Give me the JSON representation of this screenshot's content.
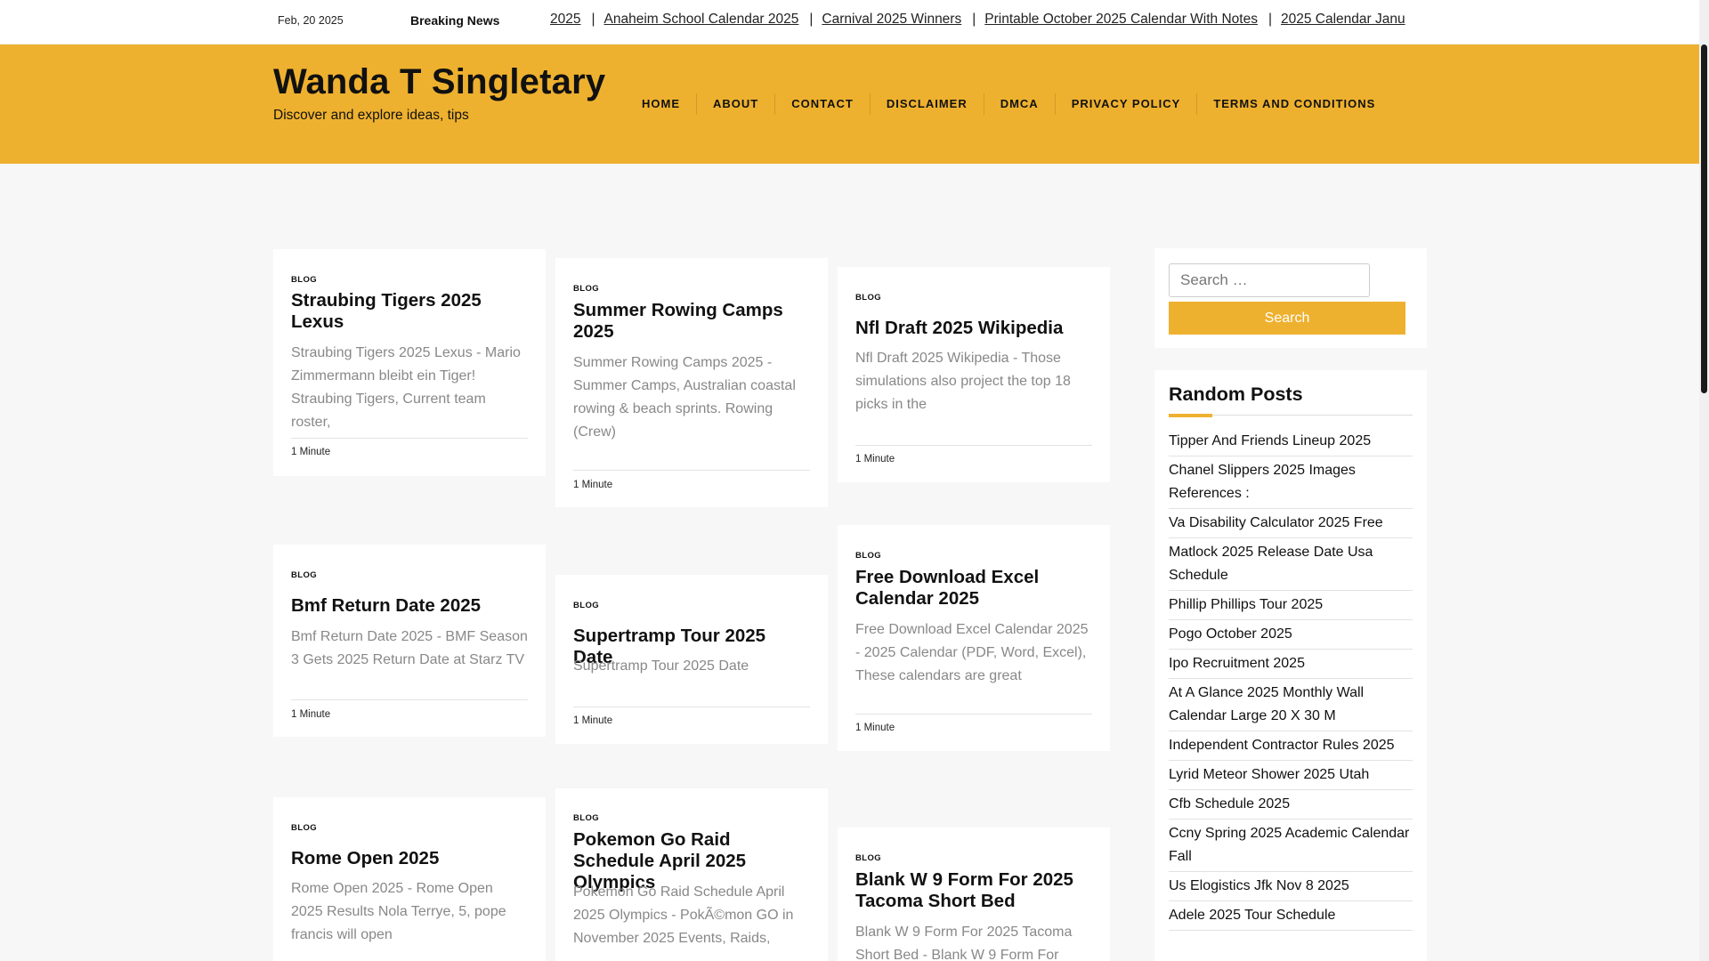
{
  "topbar": {
    "date": "Feb, 20 2025",
    "breaking_label": "Breaking News",
    "ticker": [
      "2025",
      "Anaheim School Calendar 2025",
      "Carnival 2025 Winners",
      "Printable October 2025 Calendar With Notes",
      "2025 Calendar Janu"
    ]
  },
  "header": {
    "site_title": "Wanda T Singletary",
    "tagline": "Discover and explore ideas, tips",
    "nav": [
      "HOME",
      "ABOUT",
      "CONTACT",
      "DISCLAIMER",
      "DMCA",
      "PRIVACY POLICY",
      "TERMS AND CONDITIONS"
    ]
  },
  "posts": [
    {
      "category": "BLOG",
      "title": "Straubing Tigers 2025 Lexus",
      "excerpt": "Straubing Tigers 2025 Lexus - Mario Zimmermann bleibt ein Tiger! Straubing Tigers, Current team roster,",
      "read_time": "1 Minute"
    },
    {
      "category": "BLOG",
      "title": "Summer Rowing Camps 2025",
      "excerpt": "Summer Rowing Camps 2025 - Summer Camps, Australian coastal rowing & beach sprints. Rowing (Crew)",
      "read_time": "1 Minute"
    },
    {
      "category": "BLOG",
      "title": "Nfl Draft 2025 Wikipedia",
      "excerpt": "Nfl Draft 2025 Wikipedia - Those simulations also project the top 18 picks in the",
      "read_time": "1 Minute"
    },
    {
      "category": "BLOG",
      "title": "Bmf Return Date 2025",
      "excerpt": "Bmf Return Date 2025 - BMF Season 3 Gets 2025 Return Date at Starz TV",
      "read_time": "1 Minute"
    },
    {
      "category": "BLOG",
      "title": "Supertramp Tour 2025 Date",
      "excerpt": "Supertramp Tour 2025 Date",
      "read_time": "1 Minute"
    },
    {
      "category": "BLOG",
      "title": "Free Download Excel Calendar 2025",
      "excerpt": "Free Download Excel Calendar 2025 - 2025 Calendar (PDF, Word, Excel), These calendars are great",
      "read_time": "1 Minute"
    },
    {
      "category": "BLOG",
      "title": "Rome Open 2025",
      "excerpt": "Rome Open 2025 - Rome Open 2025 Results Nola Terrye, 5, pope francis will open",
      "read_time": ""
    },
    {
      "category": "BLOG",
      "title": "Pokemon Go Raid Schedule April 2025 Olympics",
      "excerpt": "Pokemon Go Raid Schedule April 2025 Olympics - PokÃ©mon GO in November 2025 Events, Raids,",
      "read_time": ""
    },
    {
      "category": "BLOG",
      "title": "Blank W 9 Form For 2025 Tacoma Short Bed",
      "excerpt": "Blank W 9 Form For 2025 Tacoma Short Bed - Blank W 9 Form For",
      "read_time": ""
    }
  ],
  "sidebar": {
    "search": {
      "placeholder": "Search …",
      "button": "Search"
    },
    "random_posts_title": "Random Posts",
    "random_posts": [
      "Tipper And Friends Lineup 2025",
      "Chanel Slippers 2025 Images References :",
      "Va Disability Calculator 2025 Free",
      "Matlock 2025 Release Date Usa Schedule",
      "Phillip Phillips Tour 2025",
      "Pogo October 2025",
      "Ipo Recruitment 2025",
      "At A Glance 2025 Monthly Wall Calendar Large 20 X 30 M",
      "Independent Contractor Rules 2025",
      "Lyrid Meteor Shower 2025 Utah",
      "Cfb Schedule 2025",
      "Ccny Spring 2025 Academic Calendar Fall",
      "Us Elogistics Jfk Nov 8 2025",
      "Adele 2025 Tour Schedule"
    ]
  },
  "colors": {
    "accent": "#eeb12f",
    "background": "#f7f7f7",
    "card": "#ffffff"
  }
}
